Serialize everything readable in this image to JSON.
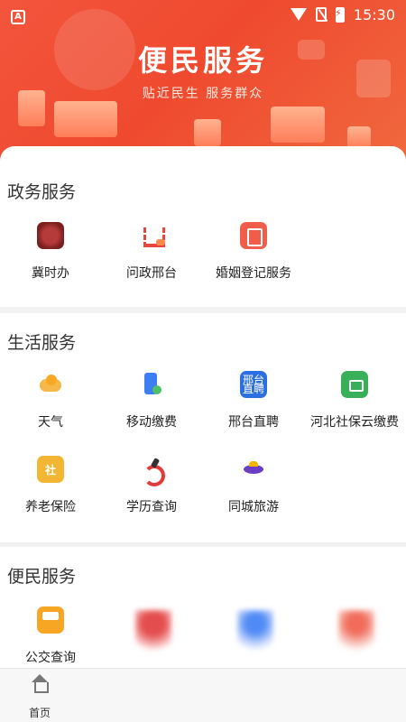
{
  "status_bar": {
    "time": "15:30",
    "left_icon": "app-notification-icon",
    "icons": [
      "wifi-icon",
      "no-sim-icon",
      "battery-charging-icon"
    ]
  },
  "banner": {
    "title": "便民服务",
    "subtitle": "贴近民生 服务群众"
  },
  "gov_services": {
    "title": "政务服务",
    "items": [
      {
        "label": "冀时办",
        "icon": "seal-icon"
      },
      {
        "label": "问政邢台",
        "icon": "government-building-icon"
      },
      {
        "label": "婚姻登记服务",
        "icon": "marriage-certificate-icon"
      }
    ]
  },
  "life_services": {
    "title": "生活服务",
    "items": [
      {
        "label": "天气",
        "icon": "weather-icon"
      },
      {
        "label": "移动缴费",
        "icon": "mobile-payment-icon"
      },
      {
        "label": "邢台直聘",
        "icon": "jobs-icon",
        "icon_text": "邢台直聘"
      },
      {
        "label": "河北社保云缴费",
        "icon": "social-security-icon"
      },
      {
        "label": "养老保险",
        "icon": "pension-shield-icon",
        "icon_text": "社"
      },
      {
        "label": "学历查询",
        "icon": "education-icon"
      },
      {
        "label": "同城旅游",
        "icon": "travel-icon"
      }
    ]
  },
  "convenience_services": {
    "title": "便民服务",
    "items": [
      {
        "label": "公交查询",
        "icon": "bus-icon"
      }
    ]
  },
  "tabbar": {
    "home_label": "首页"
  },
  "colors": {
    "banner": "#ef4a2f",
    "card_bg": "#ffffff",
    "page_bg": "#f2f2f2"
  }
}
